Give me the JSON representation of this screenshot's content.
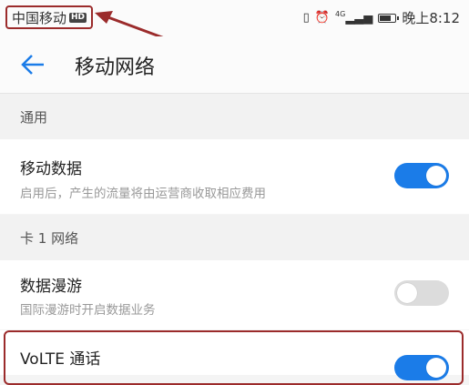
{
  "status_bar": {
    "carrier": "中国移动",
    "hd_badge": "HD",
    "time": "晚上8:12",
    "network_label": "4G",
    "icons": [
      "vibrate-icon",
      "alarm-icon",
      "signal-icon",
      "battery-icon"
    ]
  },
  "header": {
    "title": "移动网络",
    "back_icon": "arrow-left-icon"
  },
  "sections": {
    "general": "通用",
    "card1": "卡 1 网络"
  },
  "settings": {
    "mobile_data": {
      "title": "移动数据",
      "subtitle": "启用后，产生的流量将由运营商收取相应费用",
      "enabled": true
    },
    "data_roaming": {
      "title": "数据漫游",
      "subtitle": "国际漫游时开启数据业务",
      "enabled": false
    },
    "volte": {
      "title": "VoLTE 通话",
      "enabled": true
    }
  },
  "colors": {
    "toggle_on": "#1b7ce8",
    "toggle_off": "#dcdcdc",
    "back_arrow": "#1b7ce8",
    "annotation": "#9b2b2b"
  }
}
